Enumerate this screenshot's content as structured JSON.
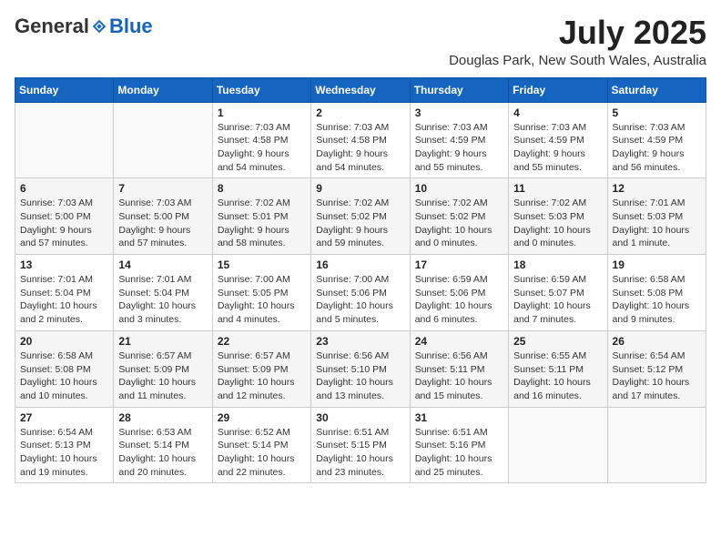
{
  "header": {
    "logo": {
      "general": "General",
      "blue": "Blue"
    },
    "title": "July 2025",
    "location": "Douglas Park, New South Wales, Australia"
  },
  "weekdays": [
    "Sunday",
    "Monday",
    "Tuesday",
    "Wednesday",
    "Thursday",
    "Friday",
    "Saturday"
  ],
  "weeks": [
    [
      {
        "day": "",
        "info": ""
      },
      {
        "day": "",
        "info": ""
      },
      {
        "day": "1",
        "info": "Sunrise: 7:03 AM\nSunset: 4:58 PM\nDaylight: 9 hours and 54 minutes."
      },
      {
        "day": "2",
        "info": "Sunrise: 7:03 AM\nSunset: 4:58 PM\nDaylight: 9 hours and 54 minutes."
      },
      {
        "day": "3",
        "info": "Sunrise: 7:03 AM\nSunset: 4:59 PM\nDaylight: 9 hours and 55 minutes."
      },
      {
        "day": "4",
        "info": "Sunrise: 7:03 AM\nSunset: 4:59 PM\nDaylight: 9 hours and 55 minutes."
      },
      {
        "day": "5",
        "info": "Sunrise: 7:03 AM\nSunset: 4:59 PM\nDaylight: 9 hours and 56 minutes."
      }
    ],
    [
      {
        "day": "6",
        "info": "Sunrise: 7:03 AM\nSunset: 5:00 PM\nDaylight: 9 hours and 57 minutes."
      },
      {
        "day": "7",
        "info": "Sunrise: 7:03 AM\nSunset: 5:00 PM\nDaylight: 9 hours and 57 minutes."
      },
      {
        "day": "8",
        "info": "Sunrise: 7:02 AM\nSunset: 5:01 PM\nDaylight: 9 hours and 58 minutes."
      },
      {
        "day": "9",
        "info": "Sunrise: 7:02 AM\nSunset: 5:02 PM\nDaylight: 9 hours and 59 minutes."
      },
      {
        "day": "10",
        "info": "Sunrise: 7:02 AM\nSunset: 5:02 PM\nDaylight: 10 hours and 0 minutes."
      },
      {
        "day": "11",
        "info": "Sunrise: 7:02 AM\nSunset: 5:03 PM\nDaylight: 10 hours and 0 minutes."
      },
      {
        "day": "12",
        "info": "Sunrise: 7:01 AM\nSunset: 5:03 PM\nDaylight: 10 hours and 1 minute."
      }
    ],
    [
      {
        "day": "13",
        "info": "Sunrise: 7:01 AM\nSunset: 5:04 PM\nDaylight: 10 hours and 2 minutes."
      },
      {
        "day": "14",
        "info": "Sunrise: 7:01 AM\nSunset: 5:04 PM\nDaylight: 10 hours and 3 minutes."
      },
      {
        "day": "15",
        "info": "Sunrise: 7:00 AM\nSunset: 5:05 PM\nDaylight: 10 hours and 4 minutes."
      },
      {
        "day": "16",
        "info": "Sunrise: 7:00 AM\nSunset: 5:06 PM\nDaylight: 10 hours and 5 minutes."
      },
      {
        "day": "17",
        "info": "Sunrise: 6:59 AM\nSunset: 5:06 PM\nDaylight: 10 hours and 6 minutes."
      },
      {
        "day": "18",
        "info": "Sunrise: 6:59 AM\nSunset: 5:07 PM\nDaylight: 10 hours and 7 minutes."
      },
      {
        "day": "19",
        "info": "Sunrise: 6:58 AM\nSunset: 5:08 PM\nDaylight: 10 hours and 9 minutes."
      }
    ],
    [
      {
        "day": "20",
        "info": "Sunrise: 6:58 AM\nSunset: 5:08 PM\nDaylight: 10 hours and 10 minutes."
      },
      {
        "day": "21",
        "info": "Sunrise: 6:57 AM\nSunset: 5:09 PM\nDaylight: 10 hours and 11 minutes."
      },
      {
        "day": "22",
        "info": "Sunrise: 6:57 AM\nSunset: 5:09 PM\nDaylight: 10 hours and 12 minutes."
      },
      {
        "day": "23",
        "info": "Sunrise: 6:56 AM\nSunset: 5:10 PM\nDaylight: 10 hours and 13 minutes."
      },
      {
        "day": "24",
        "info": "Sunrise: 6:56 AM\nSunset: 5:11 PM\nDaylight: 10 hours and 15 minutes."
      },
      {
        "day": "25",
        "info": "Sunrise: 6:55 AM\nSunset: 5:11 PM\nDaylight: 10 hours and 16 minutes."
      },
      {
        "day": "26",
        "info": "Sunrise: 6:54 AM\nSunset: 5:12 PM\nDaylight: 10 hours and 17 minutes."
      }
    ],
    [
      {
        "day": "27",
        "info": "Sunrise: 6:54 AM\nSunset: 5:13 PM\nDaylight: 10 hours and 19 minutes."
      },
      {
        "day": "28",
        "info": "Sunrise: 6:53 AM\nSunset: 5:14 PM\nDaylight: 10 hours and 20 minutes."
      },
      {
        "day": "29",
        "info": "Sunrise: 6:52 AM\nSunset: 5:14 PM\nDaylight: 10 hours and 22 minutes."
      },
      {
        "day": "30",
        "info": "Sunrise: 6:51 AM\nSunset: 5:15 PM\nDaylight: 10 hours and 23 minutes."
      },
      {
        "day": "31",
        "info": "Sunrise: 6:51 AM\nSunset: 5:16 PM\nDaylight: 10 hours and 25 minutes."
      },
      {
        "day": "",
        "info": ""
      },
      {
        "day": "",
        "info": ""
      }
    ]
  ]
}
